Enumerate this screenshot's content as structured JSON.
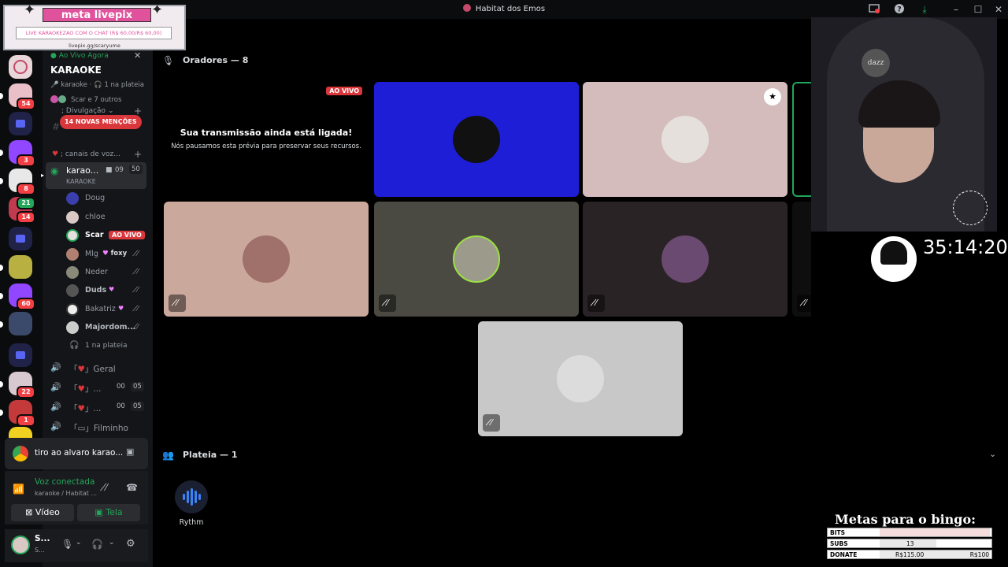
{
  "window": {
    "title": "Habitat dos Emos"
  },
  "rail": {
    "badges": [
      "54",
      "3",
      "8",
      "21",
      "14",
      "60",
      "22",
      "1"
    ]
  },
  "livepix": {
    "brand": "meta livepix",
    "goal": "LIVE KARAOKEZAO COM O CHAT (R$ 60,00/R$ 60,00)",
    "url": "livepix.gg/scaryume"
  },
  "sidebar": {
    "live_now": "Ao Vivo Agora",
    "event_title": "KARAOKE",
    "event_channel": "karaoke",
    "event_audience": "1 na plateia",
    "event_people": "Scar e 7 outros",
    "category_promo": "Divulgação",
    "mentions_badge": "14 NOVAS MENÇÕES",
    "category_voice": "canais de voz...",
    "active_channel": {
      "name": "karao...",
      "sub": "KARAOKE",
      "count1": "09",
      "count2": "50"
    },
    "members": [
      {
        "name": "Doug"
      },
      {
        "name": "chloe"
      },
      {
        "name": "Scar",
        "tag": "AO VIVO"
      },
      {
        "name": "Mlg",
        "extra": "foxy"
      },
      {
        "name": "Neder"
      },
      {
        "name": "Duds"
      },
      {
        "name": "Bakatriz"
      },
      {
        "name": "Majordom..."
      }
    ],
    "audience_row": "1 na plateia",
    "channels": [
      {
        "name": "Geral",
        "c1": "",
        "c2": ""
      },
      {
        "name": "...",
        "c1": "00",
        "c2": "05"
      },
      {
        "name": "...",
        "c1": "00",
        "c2": "05"
      },
      {
        "name": "Filminho",
        "c1": "",
        "c2": ""
      }
    ]
  },
  "activity": {
    "text": "tiro ao alvaro karao..."
  },
  "voice": {
    "status": "Voz conectada",
    "location": "karaoke / Habitat ...",
    "video_label": "Vídeo",
    "screen_label": "Tela"
  },
  "user": {
    "name": "S...",
    "sub": "S..."
  },
  "stage": {
    "speakers_header": "Oradores — 8",
    "audience_header": "Plateia — 1",
    "stream_notice_title": "Sua transmissão ainda está ligada!",
    "stream_notice_body": "Nós pausamos esta prévia para preservar seus recursos.",
    "live_badge": "AO VIVO",
    "audience": [
      {
        "name": "Rythm"
      }
    ],
    "colors": {
      "tile1": "#1d1ed6",
      "tile2": "#d4bcbd",
      "tile3": "#cba89c",
      "tile4": "#4a4a42",
      "tile5": "#2a2325",
      "tile6": "#c8c8c8"
    }
  },
  "overlay": {
    "timer": "35:14:20",
    "camera_brand": "dazz",
    "bingo_title": "Metas para o bingo:",
    "bingo": [
      {
        "label": "BITS",
        "value": "",
        "right": ""
      },
      {
        "label": "SUBS",
        "value": "13",
        "right": ""
      },
      {
        "label": "DONATE",
        "value": "R$115.00",
        "right": "R$100"
      }
    ]
  }
}
